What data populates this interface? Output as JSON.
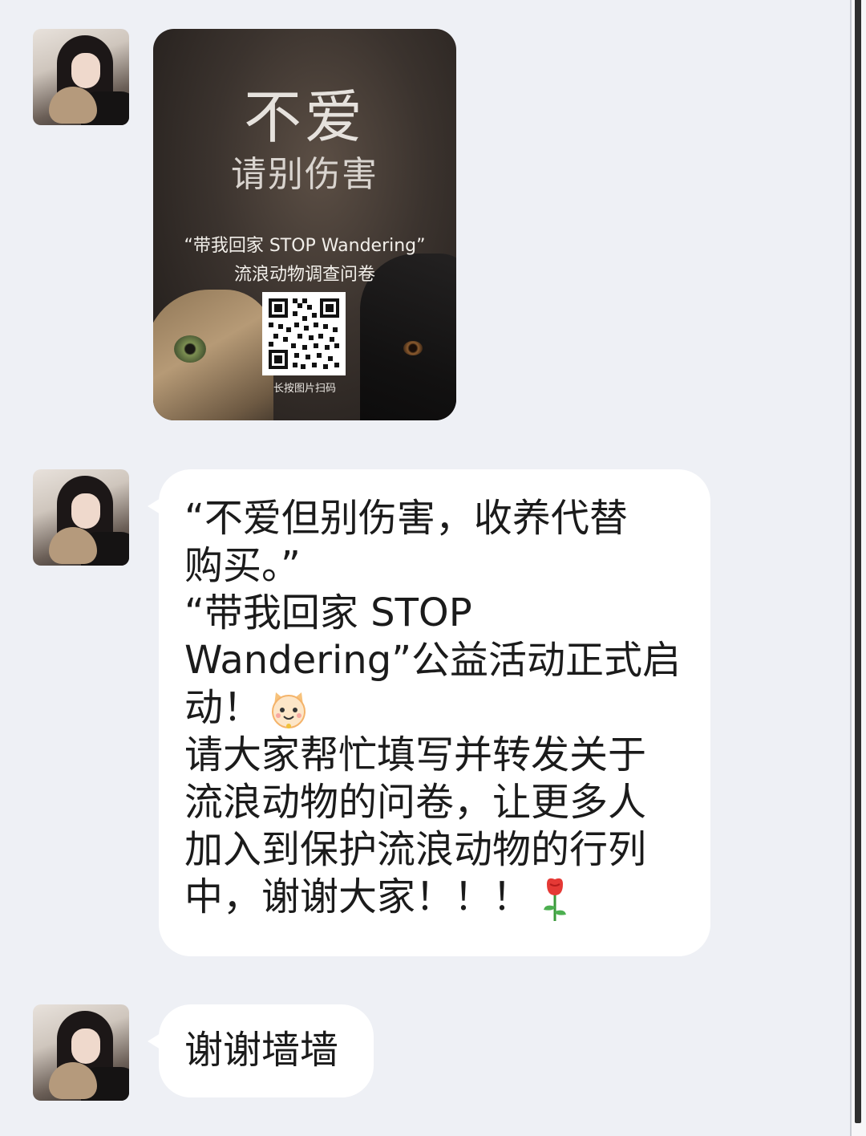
{
  "poster": {
    "title": "不爱",
    "subtitle": "请别伤害",
    "line1": "“带我回家 STOP Wandering”",
    "line2": "流浪动物调查问卷",
    "qr_caption": "长按图片扫码"
  },
  "message2": {
    "part1": "“不爱但别伤害，收养代替\n购买。”\n“带我回家 STOP\nWandering”公益活动正式启\n动！",
    "emoji1": "cat-emoji",
    "part2": "\n请大家帮忙填写并转发关于\n流浪动物的问卷，让更多人\n加入到保护流浪动物的行列\n中，谢谢大家！！！",
    "emoji2": "rose-emoji"
  },
  "message3": {
    "text": "谢谢墙墙"
  },
  "colors": {
    "background": "#eef0f5",
    "bubble": "#ffffff",
    "text": "#1b1b1b"
  }
}
